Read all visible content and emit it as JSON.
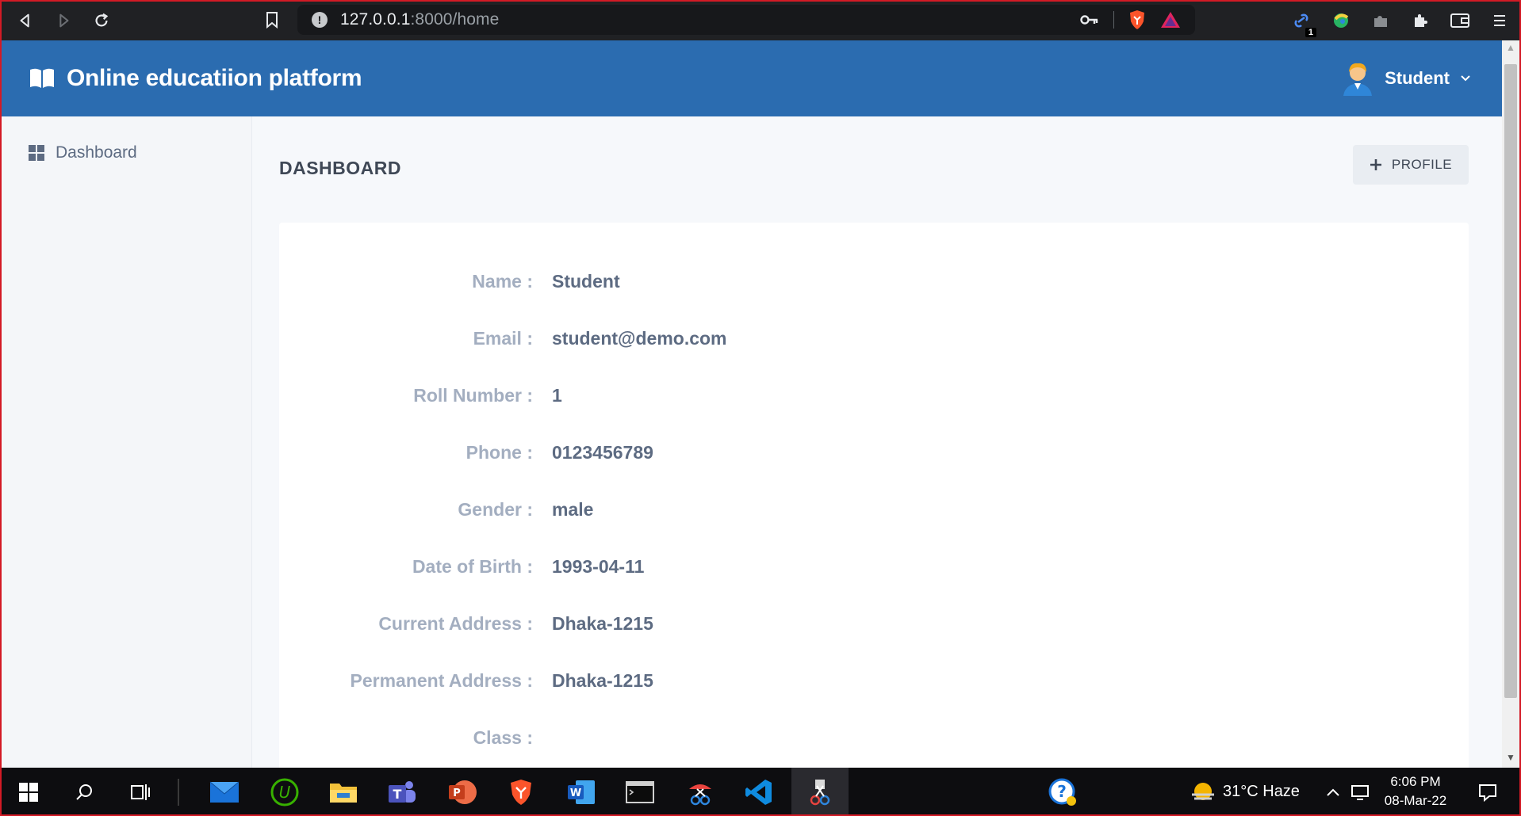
{
  "browser": {
    "url_host": "127.0.0.1",
    "url_rest": ":8000/home",
    "extension_badge": "1"
  },
  "header": {
    "app_title": "Online educatiion platform",
    "user_name": "Student"
  },
  "sidebar": {
    "items": [
      {
        "label": "Dashboard",
        "icon": "dashboard-grid-icon"
      }
    ]
  },
  "main": {
    "page_title": "DASHBOARD",
    "profile_button": "PROFILE",
    "fields": [
      {
        "label": "Name :",
        "value": "Student"
      },
      {
        "label": "Email :",
        "value": "student@demo.com"
      },
      {
        "label": "Roll Number :",
        "value": "1"
      },
      {
        "label": "Phone :",
        "value": "0123456789"
      },
      {
        "label": "Gender :",
        "value": "male"
      },
      {
        "label": "Date of Birth :",
        "value": "1993-04-11"
      },
      {
        "label": "Current Address :",
        "value": "Dhaka-1215"
      },
      {
        "label": "Permanent Address :",
        "value": "Dhaka-1215"
      },
      {
        "label": "Class :",
        "value": ""
      }
    ]
  },
  "taskbar": {
    "weather": "31°C  Haze",
    "time": "6:06 PM",
    "date": "08-Mar-22"
  },
  "colors": {
    "header_bg": "#2b6cb0",
    "label": "#a3aec0",
    "value": "#5d6b82"
  }
}
